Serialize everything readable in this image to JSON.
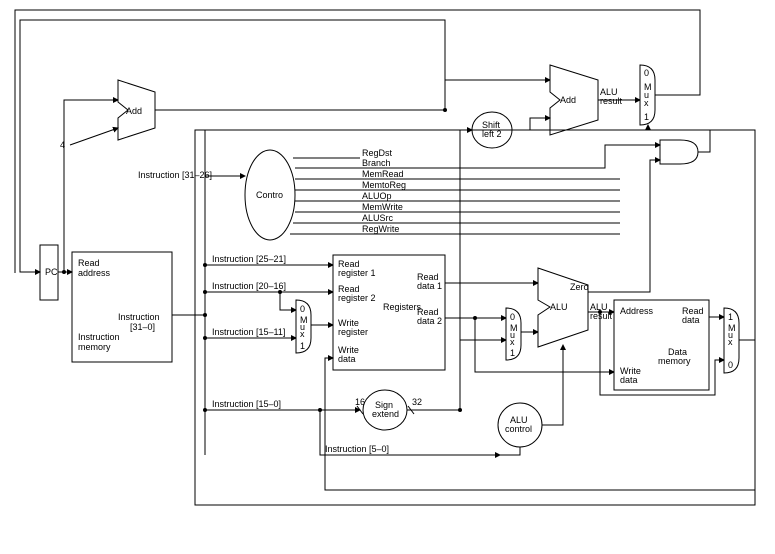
{
  "pc": {
    "label": "PC"
  },
  "imem": {
    "read_addr": "Read\naddress",
    "instr": "Instruction\n[31–0]",
    "name": "Instruction\nmemory"
  },
  "const4": "4",
  "adder1": "Add",
  "adder2": {
    "name": "Add",
    "out": "ALU\nresult"
  },
  "shift": "Shift\nleft 2",
  "mux_pc": {
    "top": "0",
    "mid": "M\nu\nx",
    "bot": "1"
  },
  "control": {
    "name": "Contro",
    "in": "Instruction [31–26]",
    "signals": [
      "RegDst",
      "Branch",
      "MemRead",
      "MemtoReg",
      "ALUOp",
      "MemWrite",
      "ALUSrc",
      "RegWrite"
    ]
  },
  "instr_fields": {
    "rs": "Instruction [25–21]",
    "rt": "Instruction [20–16]",
    "rd": "Instruction [15–11]",
    "imm": "Instruction [15–0]",
    "funct": "Instruction [5–0]"
  },
  "mux_wr": {
    "top": "0",
    "mid": "M\nu\nx",
    "bot": "1"
  },
  "regfile": {
    "rr1": "Read\nregister 1",
    "rr2": "Read\nregister 2",
    "wr": "Write\nregister",
    "wd": "Write\ndata",
    "rd1": "Read\ndata 1",
    "rd2": "Read\ndata 2",
    "name": "Registers"
  },
  "signext": {
    "name": "Sign\nextend",
    "in": "16",
    "out": "32"
  },
  "mux_alu": {
    "top": "0",
    "mid": "M\nu\nx",
    "bot": "1"
  },
  "alu": {
    "name": "ALU",
    "zero": "Zero",
    "out": "ALU\nresult"
  },
  "aluctrl": "ALU\ncontrol",
  "dmem": {
    "addr": "Address",
    "wd": "Write\ndata",
    "rd": "Read\ndata",
    "name": "Data\nmemory"
  },
  "mux_wb": {
    "top": "1",
    "mid": "M\nu\nx",
    "bot": "0"
  },
  "and": ""
}
